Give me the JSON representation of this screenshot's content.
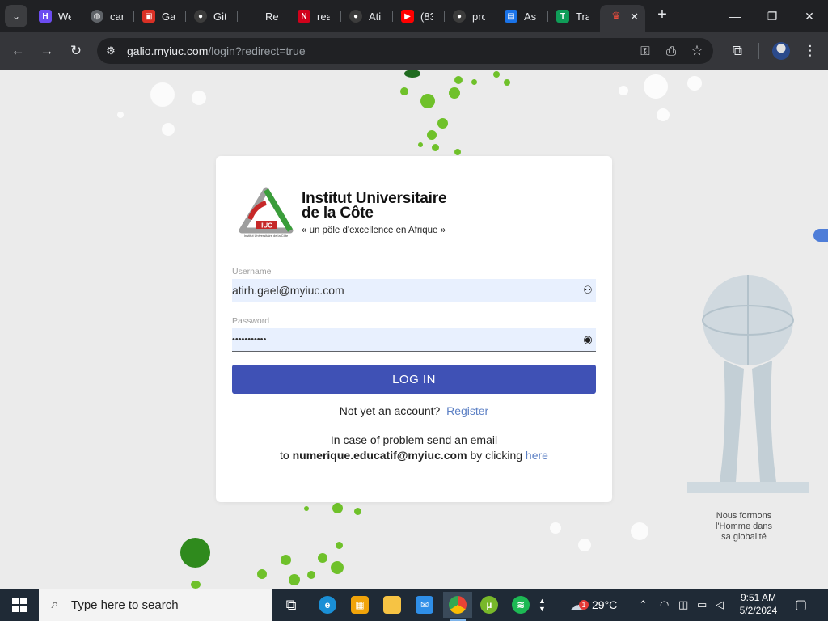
{
  "browser": {
    "tabs": [
      {
        "label": "We",
        "favicon": "h-logo-icon",
        "color": "#6c4cf0"
      },
      {
        "label": "car",
        "favicon": "globe-icon",
        "color": "#5f6368"
      },
      {
        "label": "Ga",
        "favicon": "red-square-icon",
        "color": "#d93025"
      },
      {
        "label": "Git",
        "favicon": "github-icon",
        "color": "#3c3c3c"
      },
      {
        "label": "Rea",
        "favicon": "blank-icon",
        "color": "#202124"
      },
      {
        "label": "rea",
        "favicon": "n-logo-icon",
        "color": "#d0021b"
      },
      {
        "label": "Ati",
        "favicon": "github-icon",
        "color": "#3c3c3c"
      },
      {
        "label": "(83",
        "favicon": "youtube-icon",
        "color": "#ff0000"
      },
      {
        "label": "pro",
        "favicon": "github-icon",
        "color": "#3c3c3c"
      },
      {
        "label": "Asp",
        "favicon": "chart-icon",
        "color": "#1a73e8"
      },
      {
        "label": "Tra",
        "favicon": "translate-icon",
        "color": "#0f9d58"
      }
    ],
    "active_tab": {
      "favicon": "crown-icon",
      "close": "✕"
    },
    "new_tab": "+",
    "window": {
      "minimize": "—",
      "restore": "❐",
      "close": "✕"
    },
    "url_host": "galio.myiuc.com",
    "url_path": "/login?redirect=true"
  },
  "page": {
    "institution_line1": "Institut Universitaire",
    "institution_line2": "de la Côte",
    "motto": "« un pôle d'excellence en Afrique »",
    "logo_text": "IUC",
    "logo_subtext": "Institut Universitaire de la Côte",
    "username_label": "Username",
    "username_value": "atirh.gael@myiuc.com",
    "password_label": "Password",
    "password_value": "•••••••••••",
    "login_button": "LOG IN",
    "register_prompt": "Not yet an account?",
    "register_link": "Register",
    "help_line1": "In case of problem send an email",
    "help_to": "to",
    "help_email": "numerique.educatif@myiuc.com",
    "help_by": "by clicking",
    "help_link": "here",
    "tagline_line1": "Nous formons",
    "tagline_line2": "l'Homme dans",
    "tagline_line3": "sa globalité",
    "accent_color": "#3f51b5"
  },
  "taskbar": {
    "search_placeholder": "Type here to search",
    "weather_temp": "29°C",
    "time": "9:51 AM",
    "date": "5/2/2024",
    "weather_badge": "1"
  }
}
